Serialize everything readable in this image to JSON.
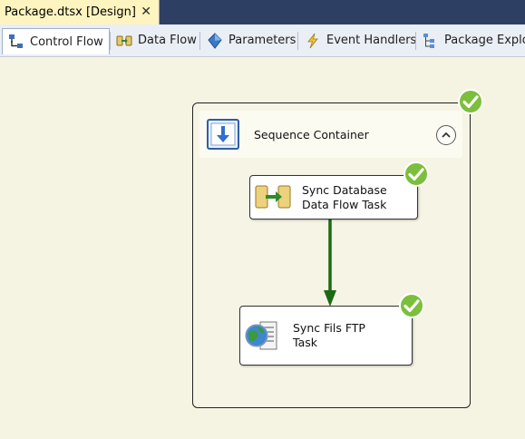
{
  "document_tab": {
    "title": "Package.dtsx [Design]",
    "close_glyph": "✕"
  },
  "designer_tabs": [
    {
      "label": "Control Flow",
      "icon": "control-flow-icon",
      "active": true
    },
    {
      "label": "Data Flow",
      "icon": "data-flow-icon"
    },
    {
      "label": "Parameters",
      "icon": "parameters-icon"
    },
    {
      "label": "Event Handlers",
      "icon": "event-handlers-icon"
    },
    {
      "label": "Package Explo",
      "icon": "package-explorer-icon"
    }
  ],
  "sequence_container": {
    "label": "Sequence Container",
    "status": "success",
    "collapse_glyph": "⌃"
  },
  "tasks": [
    {
      "label_line1": "Sync Database",
      "label_line2": "Data Flow Task",
      "icon": "data-flow-task-icon",
      "status": "success"
    },
    {
      "label_line1": "Sync Fils FTP",
      "label_line2": "Task",
      "icon": "ftp-task-icon",
      "status": "success"
    }
  ],
  "precedence_constraint": {
    "from": "Sync Database Data Flow Task",
    "to": "Sync Fils FTP Task",
    "type": "success"
  },
  "colors": {
    "surface": "#f5f4e3",
    "doc_tab": "#fdf4bf",
    "success_green": "#7cbf3c",
    "constraint_green": "#1c6b14"
  }
}
